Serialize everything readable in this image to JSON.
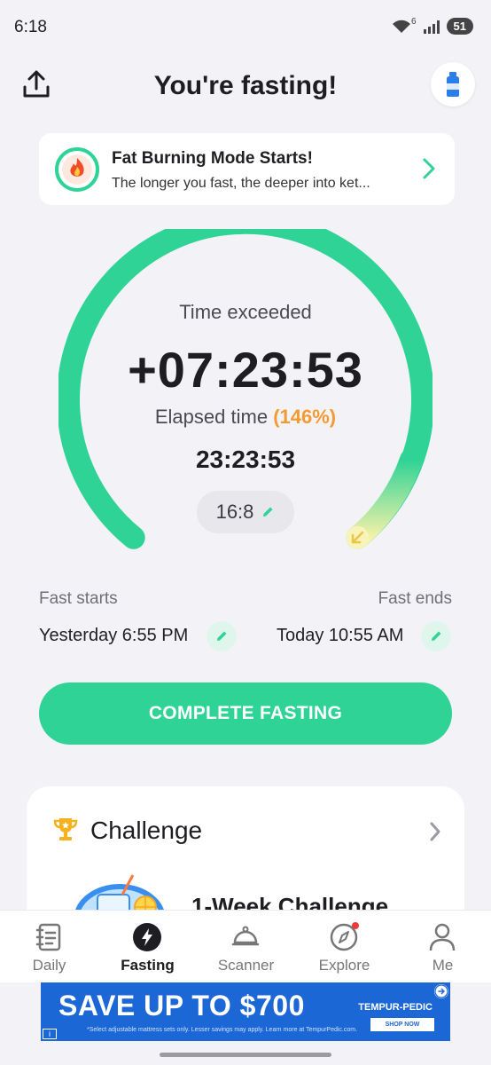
{
  "status_bar": {
    "time": "6:18",
    "signal_badge": "6",
    "battery": "51"
  },
  "header": {
    "title": "You're fasting!",
    "share_icon": "share-icon",
    "water_icon": "water-bottle-icon"
  },
  "banner": {
    "title": "Fat Burning Mode Starts!",
    "subtitle": "The longer you fast, the deeper into ket...",
    "icon": "fire-icon"
  },
  "timer": {
    "exceeded_label": "Time exceeded",
    "exceeded_value": "+07:23:53",
    "elapsed_label": "Elapsed time",
    "elapsed_percent": "(146%)",
    "elapsed_value": "23:23:53",
    "plan": "16:8",
    "progress_fraction": 1.0
  },
  "fast_window": {
    "start_label": "Fast starts",
    "start_value": "Yesterday 6:55 PM",
    "end_label": "Fast ends",
    "end_value": "Today 10:55 AM"
  },
  "actions": {
    "complete_label": "COMPLETE FASTING"
  },
  "challenge": {
    "title": "Challenge",
    "item_title": "1-Week Challenge"
  },
  "nav": {
    "items": [
      {
        "label": "Daily",
        "icon": "notebook-icon"
      },
      {
        "label": "Fasting",
        "icon": "lightning-icon"
      },
      {
        "label": "Scanner",
        "icon": "cloche-icon"
      },
      {
        "label": "Explore",
        "icon": "compass-icon"
      },
      {
        "label": "Me",
        "icon": "user-icon"
      }
    ],
    "active": "Fasting"
  },
  "ad": {
    "headline": "SAVE UP TO $700",
    "fine_print": "*Select adjustable mattress sets only. Lesser savings may apply. Learn more at TempurPedic.com.",
    "brand": "TEMPUR-PEDIC",
    "cta": "SHOP NOW"
  },
  "colors": {
    "accent": "#2fd396",
    "percent": "#f39a33",
    "background": "#f3f3f7"
  }
}
